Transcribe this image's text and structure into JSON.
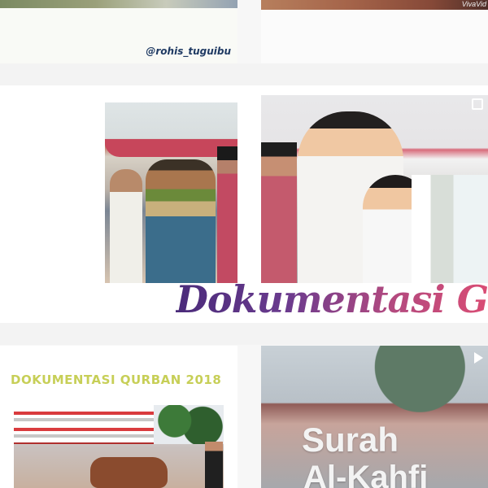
{
  "grid": {
    "tiles": {
      "top_left": {
        "handle": "@rohis_tuguibu"
      },
      "top_right": {
        "watermark": "VivaVid"
      },
      "middle": {
        "banner": "Dokumentasi Ge"
      },
      "bottom_left": {
        "title": "DOKUMENTASI QURBAN 2018"
      },
      "bottom_right": {
        "line_1": "Surah",
        "line_2": "Al-Kahfi",
        "icon": "play-icon"
      }
    }
  }
}
